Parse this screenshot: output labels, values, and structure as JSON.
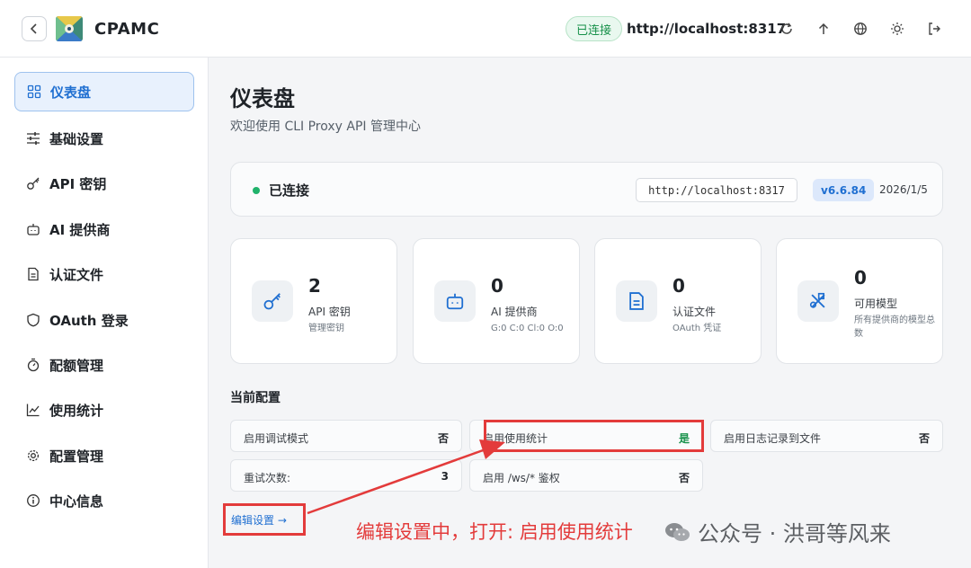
{
  "app": {
    "title": "CPAMC"
  },
  "header": {
    "status": "已连接",
    "server_url": "http://localhost:8317",
    "icons": [
      "refresh-icon",
      "upload-icon",
      "globe-icon",
      "sun-icon",
      "logout-icon"
    ]
  },
  "sidebar": {
    "items": [
      {
        "label": "仪表盘",
        "icon": "dashboard-icon",
        "active": true
      },
      {
        "label": "基础设置",
        "icon": "sliders-icon"
      },
      {
        "label": "API 密钥",
        "icon": "key-icon"
      },
      {
        "label": "AI 提供商",
        "icon": "bot-icon"
      },
      {
        "label": "认证文件",
        "icon": "file-icon"
      },
      {
        "label": "OAuth 登录",
        "icon": "shield-icon"
      },
      {
        "label": "配额管理",
        "icon": "timer-icon"
      },
      {
        "label": "使用统计",
        "icon": "chart-icon"
      },
      {
        "label": "配置管理",
        "icon": "gear-icon"
      },
      {
        "label": "中心信息",
        "icon": "info-icon"
      }
    ]
  },
  "main": {
    "title": "仪表盘",
    "subtitle": "欢迎使用 CLI Proxy API 管理中心",
    "connection": {
      "status": "已连接",
      "url": "http://localhost:8317",
      "version": "v6.6.84",
      "date": "2026/1/5"
    },
    "stats": [
      {
        "value": "2",
        "label": "API 密钥",
        "sub": "管理密钥",
        "icon": "key-icon"
      },
      {
        "value": "0",
        "label": "AI 提供商",
        "sub": "G:0 C:0 Cl:0 O:0",
        "icon": "bot-icon"
      },
      {
        "value": "0",
        "label": "认证文件",
        "sub": "OAuth 凭证",
        "icon": "file-icon"
      },
      {
        "value": "0",
        "label": "可用模型",
        "sub": "所有提供商的模型总数",
        "icon": "models-icon"
      }
    ],
    "config_title": "当前配置",
    "config": [
      {
        "key": "启用调试模式",
        "value": "否"
      },
      {
        "key": "启用使用统计",
        "value": "是"
      },
      {
        "key": "启用日志记录到文件",
        "value": "否"
      },
      {
        "key": "重试次数:",
        "value": "3"
      },
      {
        "key": "启用 /ws/* 鉴权",
        "value": "否"
      }
    ],
    "edit_link": "编辑设置 →"
  },
  "annotation": {
    "text": "编辑设置中，打开: 启用使用统计",
    "color": "#e33b3b"
  },
  "watermark": {
    "text": "公众号 · 洪哥等风来"
  },
  "colors": {
    "accent": "#1f6fd1",
    "success": "#17914a",
    "annotation": "#e33b3b"
  }
}
